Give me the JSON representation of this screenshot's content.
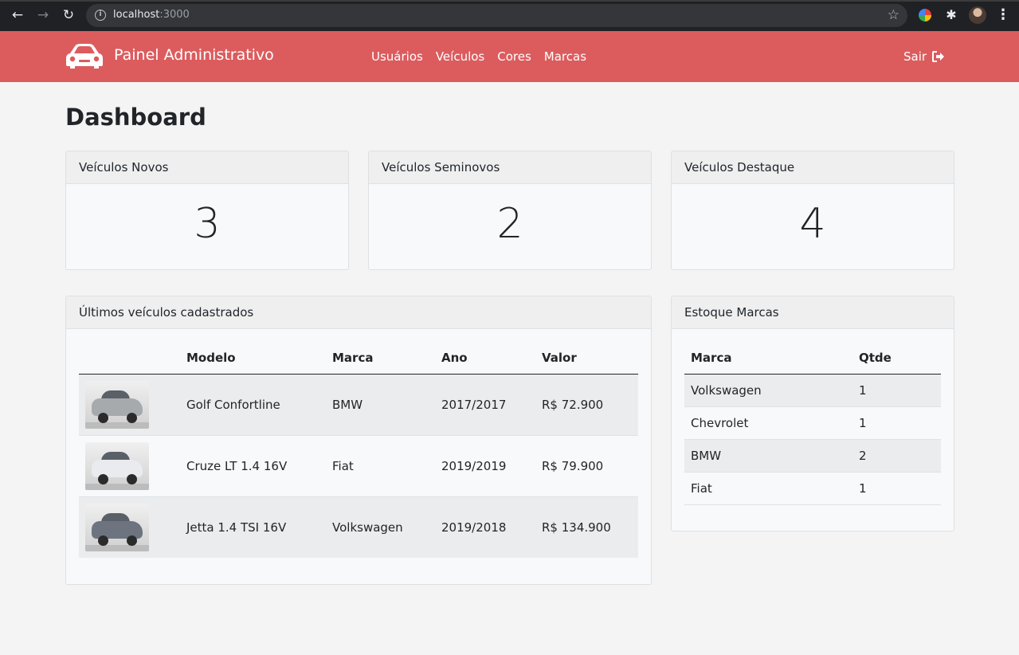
{
  "browser": {
    "url_host": "localhost",
    "url_port": ":3000"
  },
  "navbar": {
    "brand": "Painel Administrativo",
    "links": [
      "Usuários",
      "Veículos",
      "Cores",
      "Marcas"
    ],
    "logout_label": "Sair",
    "color": "#dc5c5e"
  },
  "page": {
    "title": "Dashboard"
  },
  "stats": [
    {
      "label": "Veículos Novos",
      "value": "3"
    },
    {
      "label": "Veículos Seminovos",
      "value": "2"
    },
    {
      "label": "Veículos Destaque",
      "value": "4"
    }
  ],
  "recent_vehicles": {
    "title": "Últimos veículos cadastrados",
    "columns": [
      "",
      "Modelo",
      "Marca",
      "Ano",
      "Valor"
    ],
    "rows": [
      {
        "modelo": "Golf Confortline",
        "marca": "BMW",
        "ano": "2017/2017",
        "valor": "R$ 72.900",
        "car_color": "#a7aaad"
      },
      {
        "modelo": "Cruze LT 1.4 16V",
        "marca": "Fiat",
        "ano": "2019/2019",
        "valor": "R$ 79.900",
        "car_color": "#e9ebee"
      },
      {
        "modelo": "Jetta 1.4 TSI 16V",
        "marca": "Volkswagen",
        "ano": "2019/2018",
        "valor": "R$ 134.900",
        "car_color": "#6d7480"
      }
    ]
  },
  "brand_stock": {
    "title": "Estoque Marcas",
    "columns": [
      "Marca",
      "Qtde"
    ],
    "rows": [
      {
        "marca": "Volkswagen",
        "qtde": "1"
      },
      {
        "marca": "Chevrolet",
        "qtde": "1"
      },
      {
        "marca": "BMW",
        "qtde": "2"
      },
      {
        "marca": "Fiat",
        "qtde": "1"
      }
    ]
  }
}
